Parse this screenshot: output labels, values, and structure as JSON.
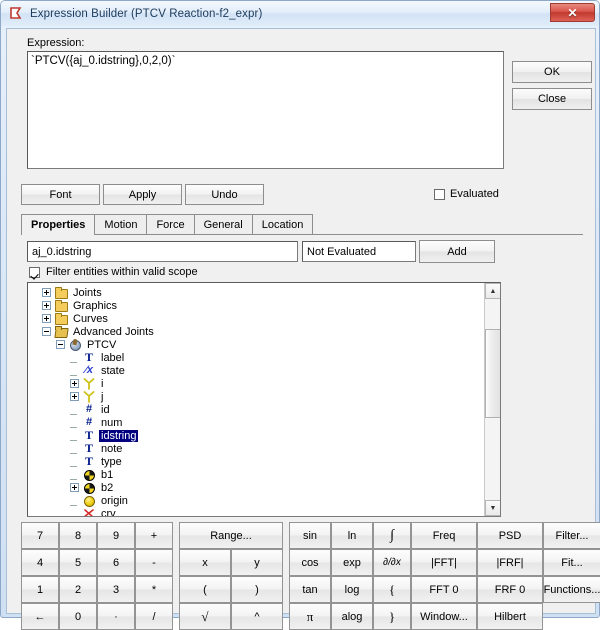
{
  "window": {
    "title": "Expression Builder (PTCV Reaction-f2_expr)",
    "app_icon": "flag-icon",
    "close_label": "✕"
  },
  "expression_section": {
    "label": "Expression:",
    "value": "`PTCV({aj_0.idstring},0,2,0)`",
    "ok_label": "OK",
    "close_label": "Close"
  },
  "action_row": {
    "font_label": "Font",
    "apply_label": "Apply",
    "undo_label": "Undo",
    "evaluated_label": "Evaluated",
    "evaluated_checked": false
  },
  "tabs": [
    {
      "label": "Properties",
      "active": true
    },
    {
      "label": "Motion",
      "active": false
    },
    {
      "label": "Force",
      "active": false
    },
    {
      "label": "General",
      "active": false
    },
    {
      "label": "Location",
      "active": false
    }
  ],
  "search_row": {
    "scope_value": "aj_0.idstring",
    "scope_placeholder": "",
    "eval_status": "Not Evaluated",
    "add_label": "Add",
    "filter_label": "Filter entities within valid scope",
    "filter_checked": true
  },
  "tree": {
    "nodes": [
      {
        "label": "Joints",
        "indent": 0,
        "toggle": "plus",
        "icon": "folder-icon",
        "selected": false
      },
      {
        "label": "Graphics",
        "indent": 0,
        "toggle": "plus",
        "icon": "folder-icon",
        "selected": false
      },
      {
        "label": "Curves",
        "indent": 0,
        "toggle": "plus",
        "icon": "folder-icon",
        "selected": false
      },
      {
        "label": "Advanced Joints",
        "indent": 0,
        "toggle": "minus",
        "icon": "folder-open-icon",
        "selected": false
      },
      {
        "label": "PTCV",
        "indent": 1,
        "toggle": "minus",
        "icon": "ptcv-joint-icon",
        "selected": false
      },
      {
        "label": "label",
        "indent": 2,
        "toggle": "none",
        "icon": "text-type-icon",
        "selected": false
      },
      {
        "label": "state",
        "indent": 2,
        "toggle": "none",
        "icon": "state-fraction-icon",
        "selected": false
      },
      {
        "label": "i",
        "indent": 2,
        "toggle": "plus",
        "icon": "marker-triad-icon",
        "selected": false
      },
      {
        "label": "j",
        "indent": 2,
        "toggle": "plus",
        "icon": "marker-triad-icon",
        "selected": false
      },
      {
        "label": "id",
        "indent": 2,
        "toggle": "none",
        "icon": "number-type-icon",
        "selected": false
      },
      {
        "label": "num",
        "indent": 2,
        "toggle": "none",
        "icon": "number-type-icon",
        "selected": false
      },
      {
        "label": "idstring",
        "indent": 2,
        "toggle": "none",
        "icon": "text-type-icon",
        "selected": true
      },
      {
        "label": "note",
        "indent": 2,
        "toggle": "none",
        "icon": "text-type-icon",
        "selected": false
      },
      {
        "label": "type",
        "indent": 2,
        "toggle": "none",
        "icon": "text-type-icon",
        "selected": false
      },
      {
        "label": "b1",
        "indent": 2,
        "toggle": "none",
        "icon": "body-sphere-icon",
        "selected": false
      },
      {
        "label": "b2",
        "indent": 2,
        "toggle": "plus",
        "icon": "body-sphere-icon",
        "selected": false
      },
      {
        "label": "origin",
        "indent": 2,
        "toggle": "none",
        "icon": "origin-sphere-icon",
        "selected": false
      },
      {
        "label": "crv",
        "indent": 2,
        "toggle": "none",
        "icon": "curve-cross-icon",
        "selected": false
      }
    ],
    "scrollbar": {
      "up_arrow": "▲",
      "down_arrow": "▼"
    }
  },
  "keypad": {
    "numpad": [
      "7",
      "8",
      "9",
      "+",
      "4",
      "5",
      "6",
      "-",
      "1",
      "2",
      "3",
      "*",
      "←",
      "0",
      "·",
      "/"
    ],
    "vars": [
      "Range...",
      "x",
      "y",
      "(",
      ")",
      "√",
      "^"
    ],
    "trig": [
      "sin",
      "cos",
      "tan",
      "π"
    ],
    "logs": [
      "ln",
      "exp",
      "log",
      "alog"
    ],
    "calculus": [
      "∫",
      "∂/∂x",
      "{",
      "}"
    ],
    "signal1": [
      "Freq",
      "|FFT|",
      "FFT 0",
      "Window..."
    ],
    "signal2": [
      "PSD",
      "|FRF|",
      "FRF 0",
      "Hilbert"
    ],
    "tools": [
      "Filter...",
      "Fit...",
      "Functions..."
    ]
  },
  "colors": {
    "title_bar": "#e3eefa",
    "close_button": "#c0392f",
    "selection": "#000080",
    "folder": "#f3cc5c",
    "marker": "#d4c21a",
    "dialog_face": "#f0f0f0"
  }
}
